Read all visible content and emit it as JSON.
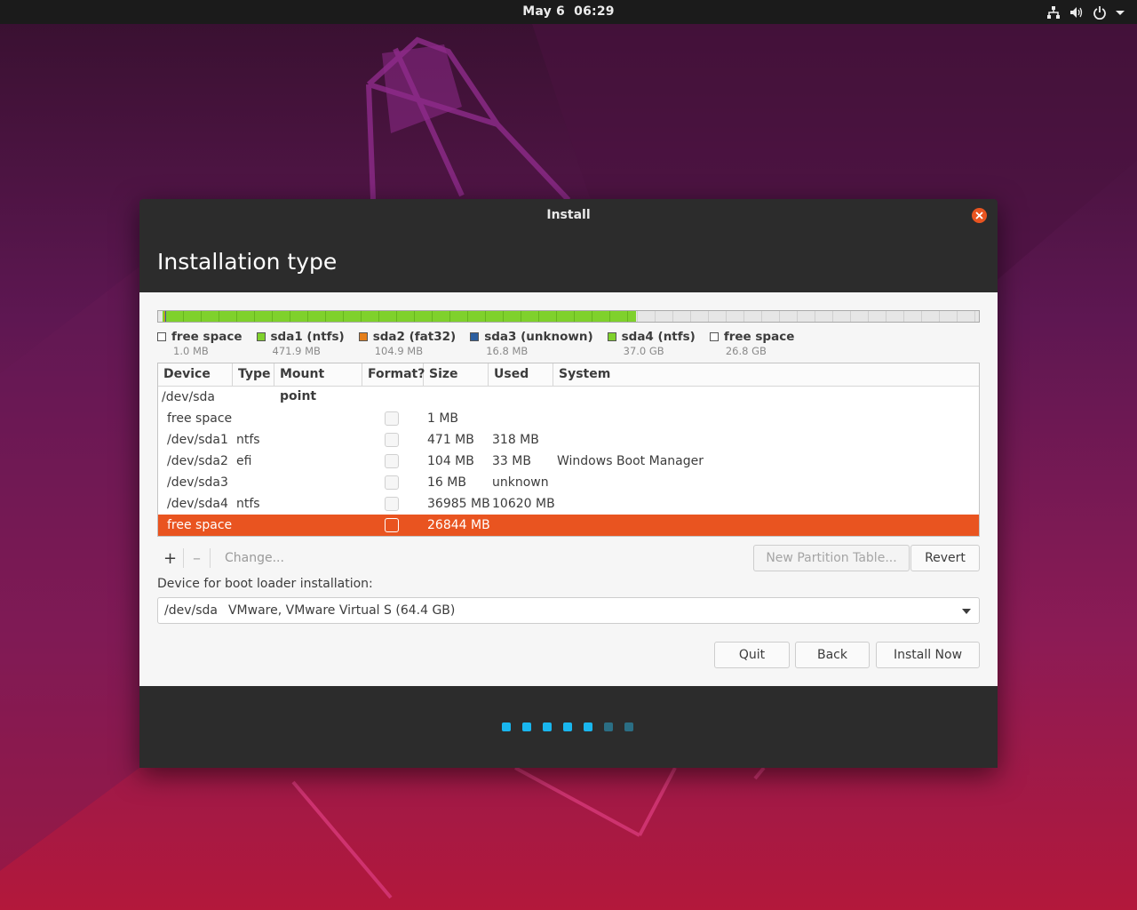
{
  "topbar": {
    "date": "May 6",
    "time": "06:29",
    "icons": [
      "network-icon",
      "volume-icon",
      "power-icon",
      "menu-arrow-icon"
    ]
  },
  "window": {
    "title": "Install",
    "page_title": "Installation type"
  },
  "partition_bar": {
    "used_fraction": 0.582,
    "colors": {
      "free": "#e6e6e6",
      "ntfs": "#7fd12c",
      "fat32": "#e57f1b",
      "unknown": "#2c5fa0"
    }
  },
  "legend": [
    {
      "label": "free space",
      "size": "1.0 MB",
      "color": "#ffffff"
    },
    {
      "label": "sda1 (ntfs)",
      "size": "471.9 MB",
      "color": "#7fd12c"
    },
    {
      "label": "sda2 (fat32)",
      "size": "104.9 MB",
      "color": "#e57f1b"
    },
    {
      "label": "sda3 (unknown)",
      "size": "16.8 MB",
      "color": "#2c5fa0"
    },
    {
      "label": "sda4 (ntfs)",
      "size": "37.0 GB",
      "color": "#7fd12c"
    },
    {
      "label": "free space",
      "size": "26.8 GB",
      "color": "#ffffff"
    }
  ],
  "table": {
    "headers": [
      "Device",
      "Type",
      "Mount point",
      "Format?",
      "Size",
      "Used",
      "System"
    ],
    "disk": "/dev/sda",
    "rows": [
      {
        "device": "free space",
        "type": "",
        "mount": "",
        "size": "1 MB",
        "used": "",
        "system": ""
      },
      {
        "device": "/dev/sda1",
        "type": "ntfs",
        "mount": "",
        "size": "471 MB",
        "used": "318 MB",
        "system": ""
      },
      {
        "device": "/dev/sda2",
        "type": "efi",
        "mount": "",
        "size": "104 MB",
        "used": "33 MB",
        "system": "Windows Boot Manager"
      },
      {
        "device": "/dev/sda3",
        "type": "",
        "mount": "",
        "size": "16 MB",
        "used": "unknown",
        "system": ""
      },
      {
        "device": "/dev/sda4",
        "type": "ntfs",
        "mount": "",
        "size": "36985 MB",
        "used": "10620 MB",
        "system": ""
      },
      {
        "device": "free space",
        "type": "",
        "mount": "",
        "size": "26844 MB",
        "used": "",
        "system": ""
      }
    ],
    "selected_row": 5
  },
  "tools": {
    "add": "+",
    "remove": "–",
    "change": "Change...",
    "new_partition_table": "New Partition Table...",
    "revert": "Revert"
  },
  "bootloader": {
    "label": "Device for boot loader installation:",
    "device": "/dev/sda",
    "description": "VMware, VMware Virtual S (64.4 GB)"
  },
  "buttons": {
    "quit": "Quit",
    "back": "Back",
    "install_now": "Install Now"
  },
  "progress": {
    "steps_total": 7,
    "steps_done": 5,
    "active_color": "#19b6ee",
    "inactive_color": "#2b6e84"
  }
}
